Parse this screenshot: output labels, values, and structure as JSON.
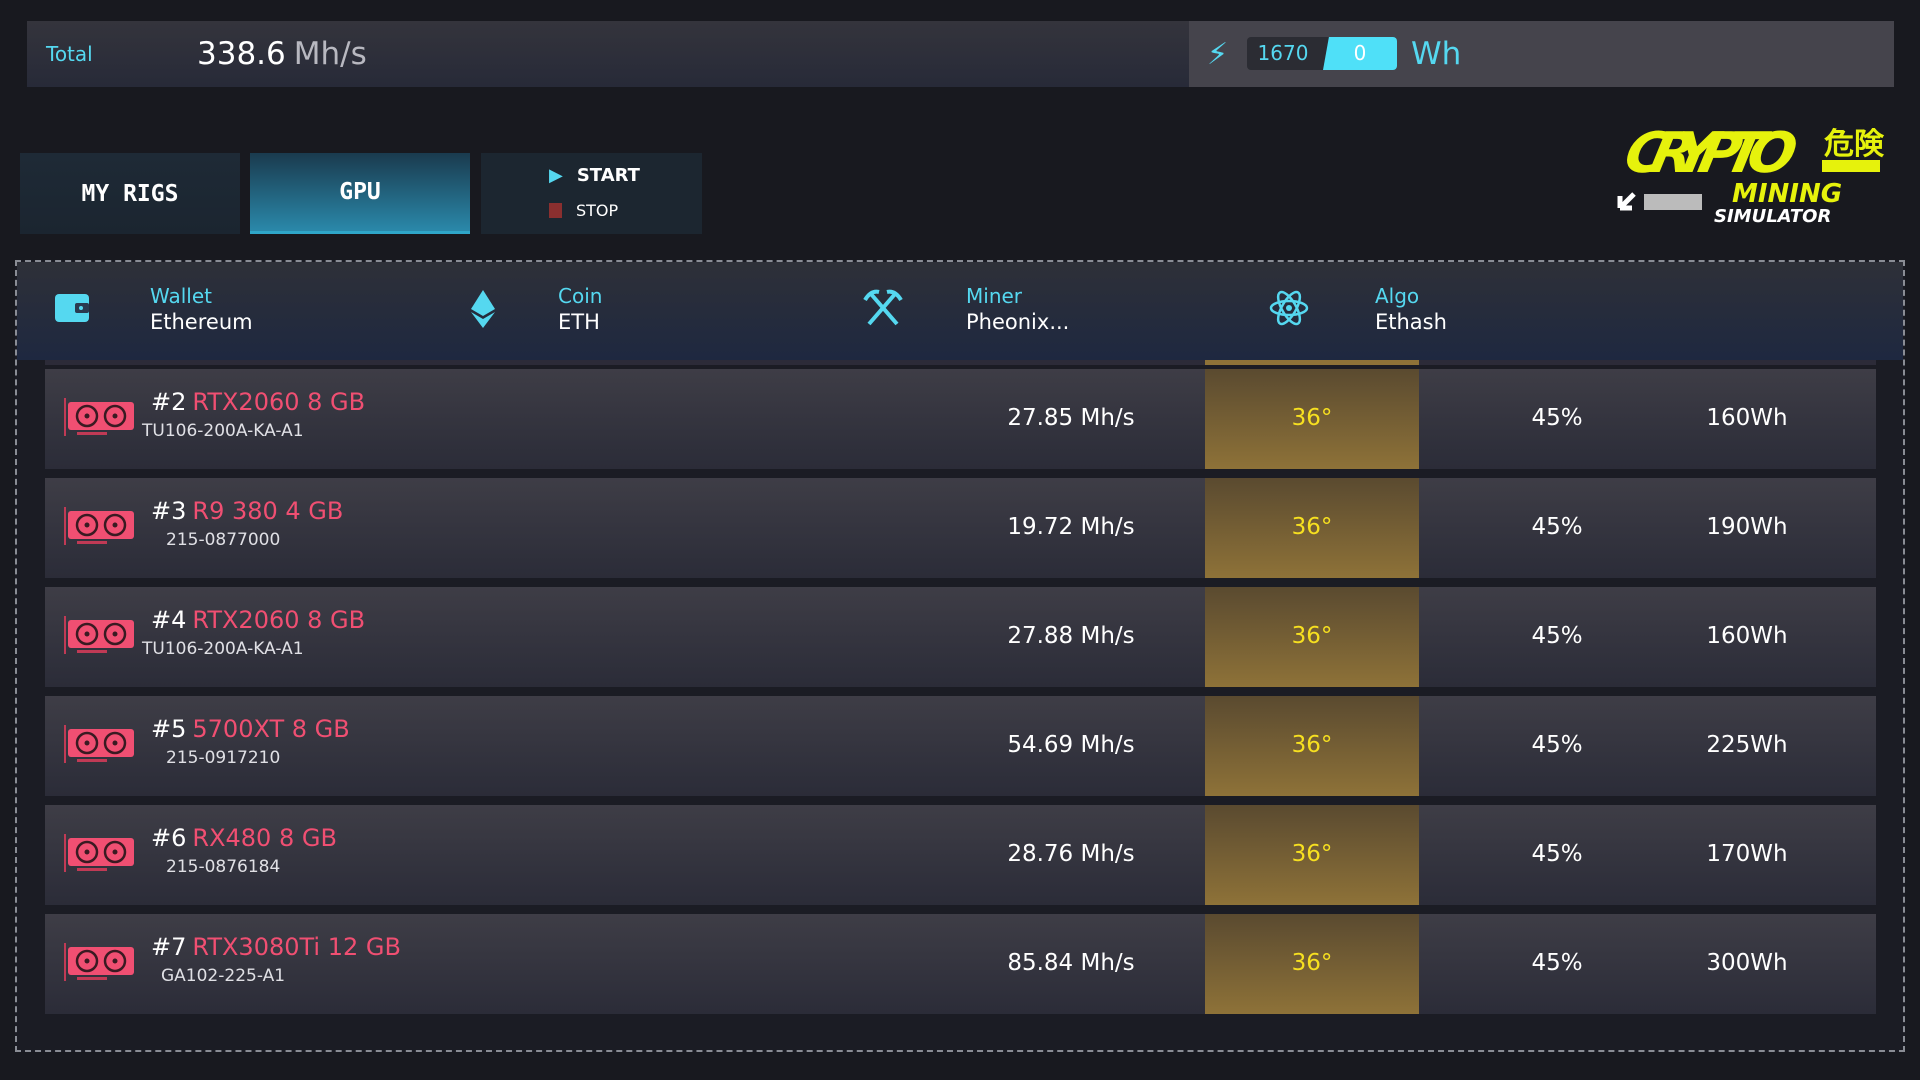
{
  "topbar": {
    "total_label": "Total",
    "total_value": "338.6",
    "total_unit": "Mh/s",
    "power_used": "1670",
    "power_value": "0",
    "power_unit": "Wh",
    "icon": "lightning-bolt-icon",
    "accent": "#55d8f0"
  },
  "tabs": [
    {
      "label": "MY RIGS",
      "active": false
    },
    {
      "label": "GPU",
      "active": true
    }
  ],
  "controls": {
    "start": "START",
    "stop": "STOP"
  },
  "logo": {
    "text": "CRYPTO MINING SIMULATOR",
    "jp": "危険"
  },
  "header": [
    {
      "key": "Wallet",
      "value": "Ethereum",
      "icon": "wallet-icon"
    },
    {
      "key": "Coin",
      "value": "ETH",
      "icon": "ethereum-icon"
    },
    {
      "key": "Miner",
      "value": "Pheonix...",
      "icon": "pickaxe-icon"
    },
    {
      "key": "Algo",
      "value": "Ethash",
      "icon": "atom-icon"
    }
  ],
  "gpus": [
    {
      "num": "#2",
      "model": "RTX2060 8 GB",
      "chip": "TU106-200A-KA-A1",
      "hashrate": "27.85 Mh/s",
      "temp": "36°",
      "fan": "45%",
      "power": "160Wh"
    },
    {
      "num": "#3",
      "model": "R9 380 4 GB",
      "chip": "215-0877000",
      "hashrate": "19.72 Mh/s",
      "temp": "36°",
      "fan": "45%",
      "power": "190Wh"
    },
    {
      "num": "#4",
      "model": "RTX2060 8 GB",
      "chip": "TU106-200A-KA-A1",
      "hashrate": "27.88 Mh/s",
      "temp": "36°",
      "fan": "45%",
      "power": "160Wh"
    },
    {
      "num": "#5",
      "model": "5700XT 8 GB",
      "chip": "215-0917210",
      "hashrate": "54.69 Mh/s",
      "temp": "36°",
      "fan": "45%",
      "power": "225Wh"
    },
    {
      "num": "#6",
      "model": "RX480 8 GB",
      "chip": "215-0876184",
      "hashrate": "28.76 Mh/s",
      "temp": "36°",
      "fan": "45%",
      "power": "170Wh"
    },
    {
      "num": "#7",
      "model": "RTX3080Ti 12 GB",
      "chip": "GA102-225-A1",
      "hashrate": "85.84 Mh/s",
      "temp": "36°",
      "fan": "45%",
      "power": "300Wh"
    }
  ]
}
